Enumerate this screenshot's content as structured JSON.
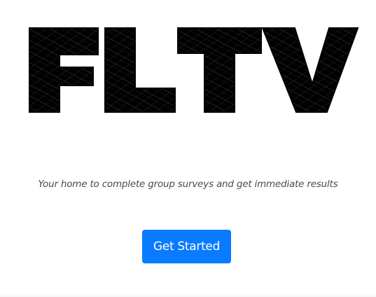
{
  "logo": {
    "text": "FLTV",
    "color": "#000000"
  },
  "hero": {
    "tagline": "Your home to complete group surveys and get immediate results"
  },
  "cta": {
    "label": "Get Started",
    "color": "#0a7bff"
  }
}
